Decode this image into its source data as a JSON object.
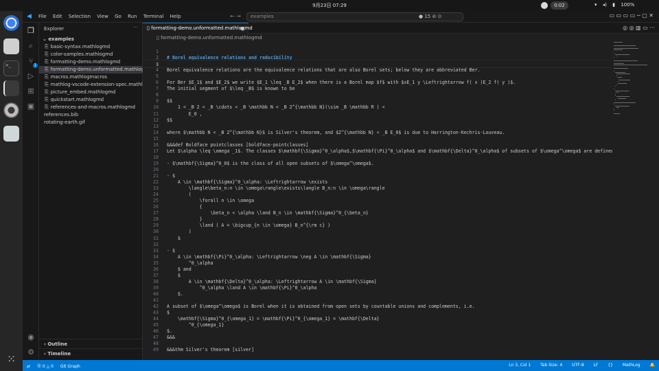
{
  "topbar": {
    "datetime": "9月23日 07:29",
    "recording": "0:02",
    "battery": "100%"
  },
  "window": {
    "menu": [
      "File",
      "Edit",
      "Selection",
      "View",
      "Go",
      "Run",
      "Terminal",
      "Help"
    ],
    "search_placeholder": "examples",
    "problems_badge": "15",
    "nav_glyph": "← →",
    "winctl_glyph": "▭ ▭ ▭ ▭  ─ ▢ ✕"
  },
  "activity": {
    "scm_count": "1"
  },
  "sidebar": {
    "title": "Explorer",
    "more": "···",
    "folder": "examples",
    "files": [
      {
        "name": "basic-syntax.mathlogmd",
        "nested": true
      },
      {
        "name": "color-samples.mathlogmd",
        "nested": true
      },
      {
        "name": "formatting-demo.mathlogmd",
        "nested": true
      },
      {
        "name": "formatting-demo.unformatted.mathlogmd",
        "nested": true,
        "selected": true
      },
      {
        "name": "macros.mathlogmacros",
        "nested": true
      },
      {
        "name": "mathlog-vscode-extension-spec.mathlogmd",
        "nested": true
      },
      {
        "name": "picture_embed.mathlogmd",
        "nested": true
      },
      {
        "name": "quickstart.mathlogmd",
        "nested": true
      },
      {
        "name": "references-and-macros.mathlogmd",
        "nested": true
      },
      {
        "name": "references.bib",
        "nested": false
      },
      {
        "name": "rotating-earth.gif",
        "nested": false
      }
    ],
    "outline": "Outline",
    "timeline": "Timeline"
  },
  "editor": {
    "tab": "formatting-demo.unformatted.mathlogmd",
    "breadcrumb": "formatting-demo.unformatted.mathlogmd",
    "tab_actions": "◎ ◎ ▥ ▭ ···",
    "lines": [
      {
        "n": "1",
        "t": ""
      },
      {
        "n": "2",
        "t": "# Borel equivalence relations and reducibility",
        "heading": true
      },
      {
        "n": "3",
        "t": ""
      },
      {
        "n": "4",
        "t": "Borel equivalence relations are the equivalence relations that are also Borel sets; below they are abbreviated Ber."
      },
      {
        "n": "5",
        "t": ""
      },
      {
        "n": "6",
        "t": "For Ber $E_1$ and $E_2$ we write $E_1 \\leq _B E_2$ when there is a Borel map $f$ with $xE_1 y \\Leftrightarrow f( x )E_2 f( y )$."
      },
      {
        "n": "7",
        "t": "The initial segment of $\\leq _B$ is known to be"
      },
      {
        "n": "8",
        "t": ""
      },
      {
        "n": "9",
        "t": "$$"
      },
      {
        "n": "10",
        "t": "    1 < _B 2 < _B \\cdots < _B \\mathbb N < _B 2^{\\mathbb N}(\\sim _B \\mathbb R ) <"
      },
      {
        "n": "11",
        "t": "        E_0 ,"
      },
      {
        "n": "12",
        "t": "$$"
      },
      {
        "n": "13",
        "t": ""
      },
      {
        "n": "14",
        "t": "where $\\mathbb N < _B 2^{\\mathbb N}$ is Silver's theorem, and $2^{\\mathbb N} < _B E_0$ is due to Harrington-Kechris-Louveau."
      },
      {
        "n": "15",
        "t": ""
      },
      {
        "n": "16",
        "t": "&&&def Boldface pointclasses [boldface-pointclasses]"
      },
      {
        "n": "17",
        "t": "Let $\\alpha \\leq \\omega _1$. The classes $\\mathbf{\\Sigma}^0_\\alpha$,$\\mathbf{\\Pi}^0_\\alpha$ and $\\mathbf{\\Delta}^0_\\alpha$ of subsets of $\\omega^\\omega$ are defined as follows."
      },
      {
        "n": "18",
        "t": ""
      },
      {
        "n": "19",
        "t": "- $\\mathbf{\\Sigma}^0_0$ is the class of all open subsets of $\\omega^\\omega$."
      },
      {
        "n": "20",
        "t": ""
      },
      {
        "n": "21",
        "t": "- $"
      },
      {
        "n": "22",
        "t": "    A \\in \\mathbf{\\Sigma}^0_\\alpha: \\Leftrightarrow \\exists"
      },
      {
        "n": "23",
        "t": "        \\langle\\beta_n:n \\in \\omega\\rangle\\exists\\langle B_n:n \\in \\omega\\rangle"
      },
      {
        "n": "24",
        "t": "        ("
      },
      {
        "n": "25",
        "t": "            \\forall n \\in \\omega"
      },
      {
        "n": "26",
        "t": "            {"
      },
      {
        "n": "27",
        "t": "                \\beta_n < \\alpha \\land B_n \\in \\mathbf{\\Sigma}^0_{\\beta_n}"
      },
      {
        "n": "28",
        "t": "            }"
      },
      {
        "n": "29",
        "t": "            \\land ( A = \\bigcup_{n \\in \\omega} B_n^{\\rm c} )"
      },
      {
        "n": "30",
        "t": "        )"
      },
      {
        "n": "31",
        "t": "    $"
      },
      {
        "n": "32",
        "t": ""
      },
      {
        "n": "33",
        "t": "- $"
      },
      {
        "n": "34",
        "t": "    A \\in \\mathbf{\\Pi}^0_\\alpha: \\Leftrightarrow \\neg A \\in \\mathbf{\\Sigma}"
      },
      {
        "n": "35",
        "t": "        ^0_\\alpha"
      },
      {
        "n": "36",
        "t": "    $ and"
      },
      {
        "n": "37",
        "t": "    $"
      },
      {
        "n": "38",
        "t": "        A \\in \\mathbf{\\Delta}^0_\\alpha: \\Leftrightarrow A \\in \\mathbf{\\Sigma}"
      },
      {
        "n": "39",
        "t": "            ^0_\\alpha \\land A \\in \\mathbf{\\Pi}^0_\\alpha"
      },
      {
        "n": "40",
        "t": "    $."
      },
      {
        "n": "41",
        "t": ""
      },
      {
        "n": "42",
        "t": "A subset of $\\omega^\\omega$ is Borel when it is obtained from open sets by countable unions and complements, i.e."
      },
      {
        "n": "43",
        "t": "$"
      },
      {
        "n": "44",
        "t": "    \\mathbf{\\Sigma}^0_{\\omega_1} = \\mathbf{\\Pi}^0_{\\omega_1} = \\mathbf{\\Delta}"
      },
      {
        "n": "45",
        "t": "        ^0_{\\omega_1}"
      },
      {
        "n": "46",
        "t": "$."
      },
      {
        "n": "47",
        "t": "&&&"
      },
      {
        "n": "48",
        "t": ""
      },
      {
        "n": "49",
        "t": "&&&thm Silver's theorem [silver]"
      }
    ]
  },
  "statusbar": {
    "remote": "⓪ 0 △ 0",
    "git": "Git Graph",
    "position": "Ln 3, Col 1",
    "tab_size": "Tab Size: 4",
    "encoding": "UTF-8",
    "eol": "LF",
    "language": "MathLog"
  }
}
